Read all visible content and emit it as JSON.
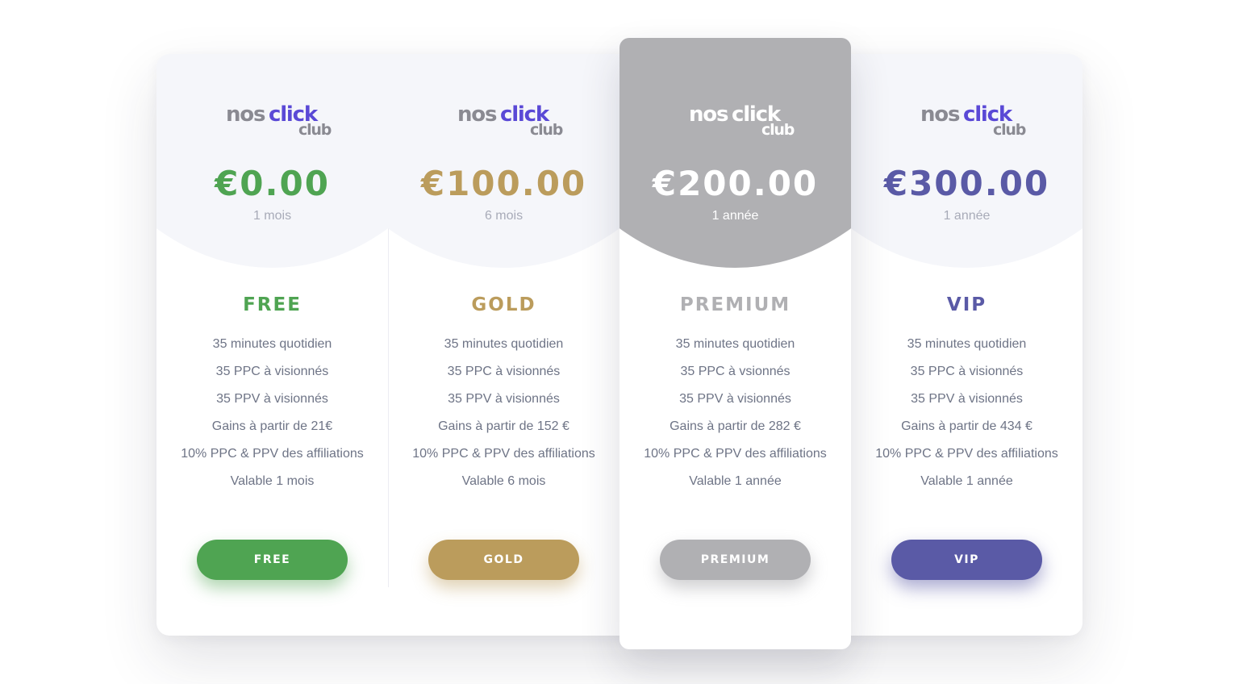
{
  "logo": {
    "part1": "nos",
    "part2": "click",
    "part3": "club"
  },
  "colors": {
    "free": "#4fa452",
    "gold": "#bb9c5c",
    "premium": "#b0b0b3",
    "vip": "#5a5aa6",
    "logo_accent": "#5a49d6",
    "feature_text": "#6e7486"
  },
  "plans": [
    {
      "price": "€0.00",
      "period": "1 mois",
      "name": "FREE",
      "features": [
        "35 minutes quotidien",
        "35 PPC à visionnés",
        "35 PPV à visionnés",
        "Gains à partir de 21€",
        "10% PPC & PPV des affiliations",
        "Valable 1 mois"
      ],
      "button": "FREE"
    },
    {
      "price": "€100.00",
      "period": "6 mois",
      "name": "GOLD",
      "features": [
        "35 minutes quotidien",
        "35 PPC à visionnés",
        "35 PPV à visionnés",
        "Gains à partir de 152 €",
        "10% PPC & PPV des affiliations",
        "Valable 6 mois"
      ],
      "button": "GOLD"
    },
    {
      "price": "€200.00",
      "period": "1 année",
      "name": "PREMIUM",
      "features": [
        "35 minutes quotidien",
        "35 PPC à vsionnés",
        "35 PPV à visionnés",
        "Gains à partir de 282 €",
        "10% PPC & PPV des affiliations",
        "Valable 1 année"
      ],
      "button": "PREMIUM"
    },
    {
      "price": "€300.00",
      "period": "1 année",
      "name": "VIP",
      "features": [
        "35 minutes quotidien",
        "35 PPC à visionnés",
        "35 PPV à visionnés",
        "Gains à partir de 434 €",
        "10% PPC & PPV des affiliations",
        "Valable 1 année"
      ],
      "button": "VIP"
    }
  ]
}
